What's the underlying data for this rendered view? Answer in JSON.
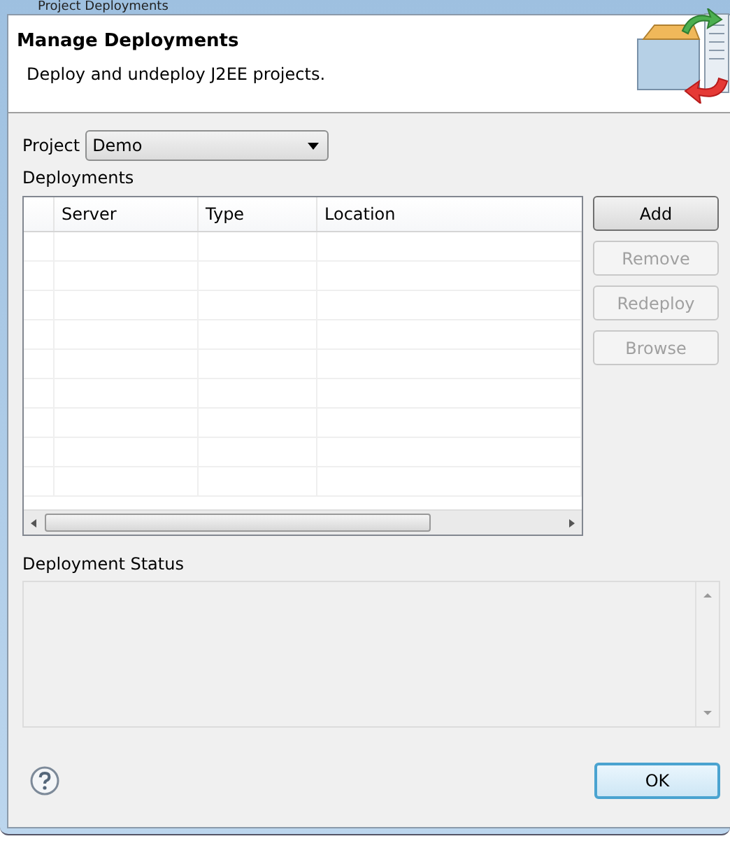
{
  "window": {
    "title": "Project Deployments"
  },
  "header": {
    "title": "Manage Deployments",
    "description": "Deploy and undeploy J2EE projects."
  },
  "project": {
    "label": "Project",
    "value": "Demo"
  },
  "deployments": {
    "label": "Deployments",
    "columns": [
      "Server",
      "Type",
      "Location"
    ],
    "buttons": [
      {
        "label": "Add",
        "disabled": false
      },
      {
        "label": "Remove",
        "disabled": true
      },
      {
        "label": "Redeploy",
        "disabled": true
      },
      {
        "label": "Browse",
        "disabled": true
      }
    ]
  },
  "status": {
    "label": "Deployment Status"
  },
  "footer": {
    "ok": "OK"
  }
}
